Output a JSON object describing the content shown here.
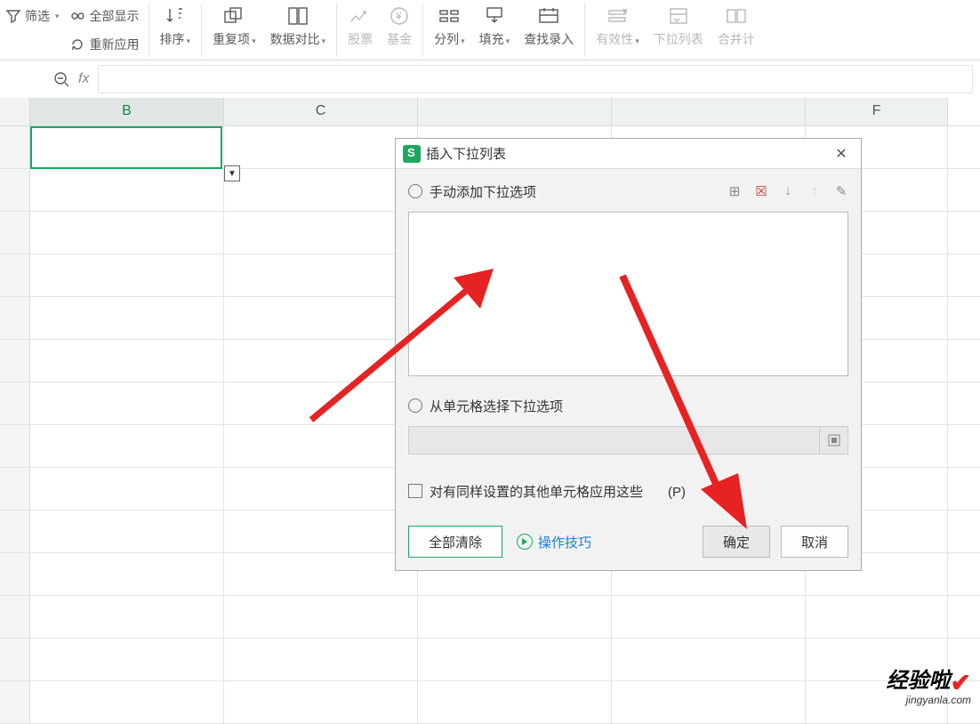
{
  "ribbon": {
    "filter": "筛选",
    "show_all": "全部显示",
    "reapply": "重新应用",
    "sort": "排序",
    "dedup": "重复项",
    "compare": "数据对比",
    "stock": "股票",
    "fund": "基金",
    "split": "分列",
    "fill": "填充",
    "find_entry": "查找录入",
    "validity": "有效性",
    "dropdown": "下拉列表",
    "merge": "合并计"
  },
  "columns": {
    "b": "B",
    "c": "C",
    "f": "F"
  },
  "dialog": {
    "title": "插入下拉列表",
    "opt_manual": "手动添加下拉选项",
    "opt_from_cells": "从单元格选择下拉选项",
    "apply_same": "对有同样设置的其他单元格应用这些",
    "apply_same_suffix": "(P)",
    "clear_all": "全部清除",
    "tips": "操作技巧",
    "ok": "确定",
    "cancel": "取消"
  },
  "watermark": {
    "line1": "经验啦",
    "line2": "jingyanla.com"
  }
}
